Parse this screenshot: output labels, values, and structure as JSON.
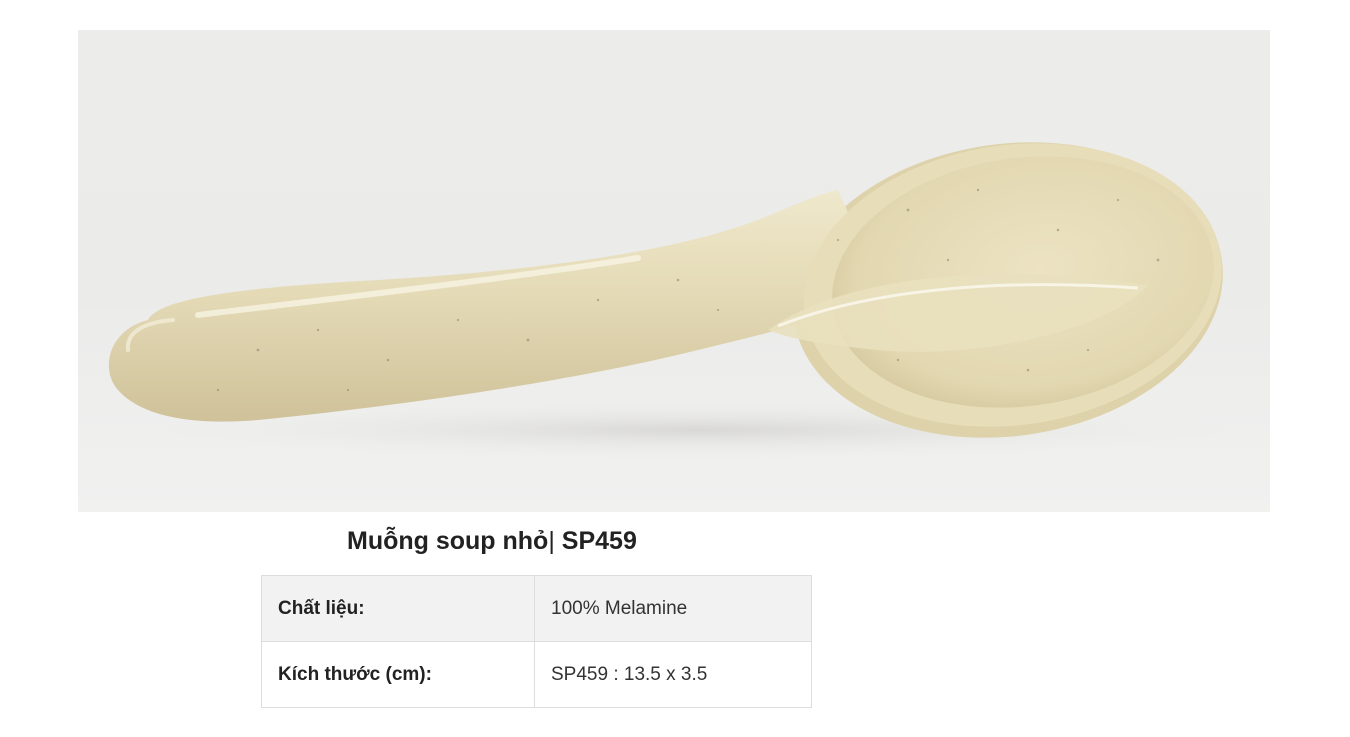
{
  "product": {
    "title_name": "Muỗng soup nhỏ",
    "title_separator": "|",
    "title_code": "SP459",
    "image_subject": "spoon-photo"
  },
  "specs": {
    "rows": [
      {
        "label": "Chất liệu:",
        "value": "100% Melamine"
      },
      {
        "label": "Kích thước (cm):",
        "value": "SP459 : 13.5 x 3.5"
      }
    ]
  },
  "colors": {
    "spoon_body": "#e3d9b4",
    "photo_background": "#ececeb",
    "table_border": "#dddddd",
    "table_shaded_row": "#f2f2f2"
  }
}
